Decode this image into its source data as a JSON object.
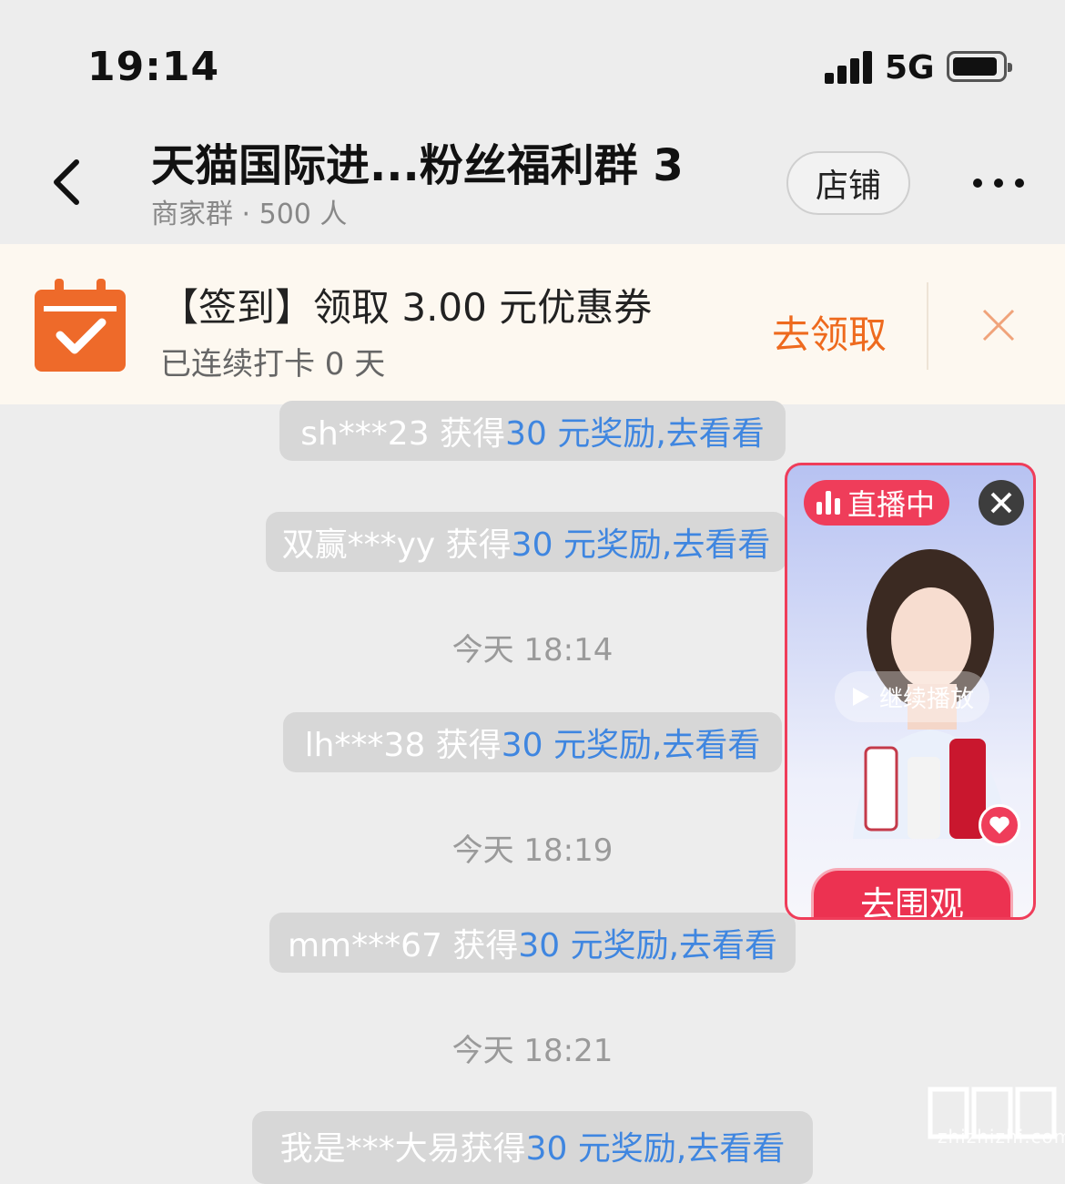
{
  "status_bar": {
    "time": "19:14",
    "network": "5G",
    "icons": [
      "signal-icon",
      "battery-icon"
    ]
  },
  "header": {
    "title": "天猫国际进...粉丝福利群 3",
    "subtitle": "商家群 · 500 人",
    "store_label": "店铺",
    "icons": [
      "back-icon",
      "more-icon"
    ]
  },
  "checkin_banner": {
    "title": "【签到】领取 3.00 元优惠券",
    "subtitle": "已连续打卡 0 天",
    "action_label": "去领取",
    "accent_color": "#ee6a1e",
    "icons": [
      "calendar-check-icon",
      "close-icon"
    ]
  },
  "messages": [
    {
      "user_text": "sh***23 获得 ",
      "link_text": "30 元奖励,去看看"
    },
    {
      "user_text": "双赢***yy 获得 ",
      "link_text": "30 元奖励,去看看"
    },
    {
      "time": "今天 18:14"
    },
    {
      "user_text": "lh***38 获得 ",
      "link_text": "30 元奖励,去看看"
    },
    {
      "time": "今天 18:19"
    },
    {
      "user_text": "mm***67 获得 ",
      "link_text": "30 元奖励,去看看"
    },
    {
      "time": "今天 18:21"
    },
    {
      "user_text": "我是***大易获得 ",
      "link_text": "30 元奖励,去看看"
    }
  ],
  "live_widget": {
    "badge_label": "直播中",
    "resume_label": "继续播放",
    "cta_label": "去围观",
    "accent_color": "#ef3d5a",
    "icons": [
      "live-bars-icon",
      "close-icon",
      "play-icon",
      "heart-icon"
    ]
  },
  "watermark": {
    "text": "zhizhizhi.com"
  }
}
